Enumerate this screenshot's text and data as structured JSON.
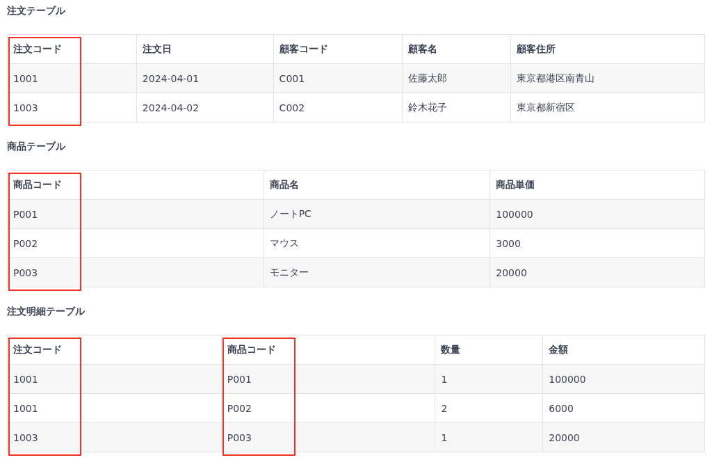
{
  "tables": [
    {
      "title": "注文テーブル",
      "columns": [
        {
          "label": "注文コード",
          "highlighted": true
        },
        {
          "label": "注文日",
          "highlighted": false
        },
        {
          "label": "顧客コード",
          "highlighted": false
        },
        {
          "label": "顧客名",
          "highlighted": false
        },
        {
          "label": "顧客住所",
          "highlighted": false
        }
      ],
      "rows": [
        [
          "1001",
          "2024-04-01",
          "C001",
          "佐藤太郎",
          "東京都港区南青山"
        ],
        [
          "1003",
          "2024-04-02",
          "C002",
          "鈴木花子",
          "東京都新宿区"
        ]
      ]
    },
    {
      "title": "商品テーブル",
      "columns": [
        {
          "label": "商品コード",
          "highlighted": true
        },
        {
          "label": "商品名",
          "highlighted": false
        },
        {
          "label": "商品単価",
          "highlighted": false
        }
      ],
      "rows": [
        [
          "P001",
          "ノートPC",
          "100000"
        ],
        [
          "P002",
          "マウス",
          "3000"
        ],
        [
          "P003",
          "モニター",
          "20000"
        ]
      ]
    },
    {
      "title": "注文明細テーブル",
      "columns": [
        {
          "label": "注文コード",
          "highlighted": true
        },
        {
          "label": "商品コード",
          "highlighted": true
        },
        {
          "label": "数量",
          "highlighted": false
        },
        {
          "label": "金額",
          "highlighted": false
        }
      ],
      "rows": [
        [
          "1001",
          "P001",
          "1",
          "100000"
        ],
        [
          "1001",
          "P002",
          "2",
          "6000"
        ],
        [
          "1003",
          "P003",
          "1",
          "20000"
        ]
      ]
    }
  ]
}
